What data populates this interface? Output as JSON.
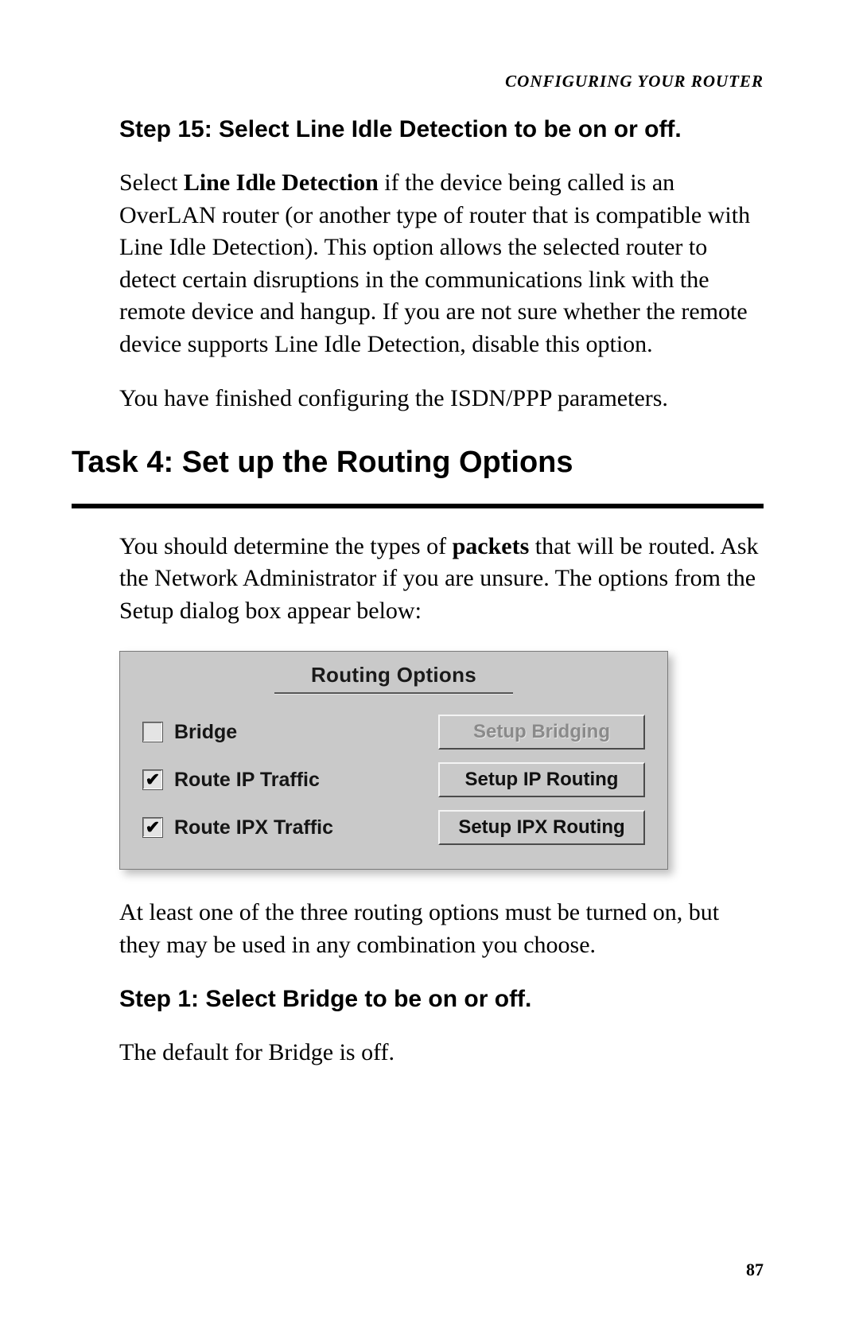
{
  "running_head": "CONFIGURING YOUR ROUTER",
  "step15": {
    "heading": "Step 15: Select Line Idle Detection to be on or off.",
    "p1_pre": "Select ",
    "p1_bold": "Line Idle Detection",
    "p1_post": " if the device being called is an OverLAN router (or another type of router that is compatible with Line Idle Detection).  This option allows the selected router to detect certain disruptions in the communications link with the remote device and hangup.  If you are not sure whether the remote device supports Line Idle Detection, disable this option.",
    "p2": "You have finished configuring the ISDN/PPP parameters."
  },
  "task4": {
    "heading": "Task 4:  Set up the Routing Options",
    "intro_pre": "You should determine the types of ",
    "intro_bold": "packets",
    "intro_post": " that will be routed.  Ask the Network Administrator if you are unsure.  The options from the Setup dialog box appear below:",
    "after_fig": "At least one of the three routing options must be turned on, but they may be used in any combination you choose."
  },
  "dialog": {
    "title": "Routing Options",
    "rows": [
      {
        "checked": false,
        "label": "Bridge",
        "button": "Setup Bridging",
        "enabled": false
      },
      {
        "checked": true,
        "label": "Route IP Traffic",
        "button": "Setup IP Routing",
        "enabled": true
      },
      {
        "checked": true,
        "label": "Route IPX Traffic",
        "button": "Setup IPX Routing",
        "enabled": true
      }
    ]
  },
  "step1": {
    "heading": "Step 1: Select Bridge to be on or off.",
    "p1": "The default for Bridge is off."
  },
  "page_number": "87"
}
